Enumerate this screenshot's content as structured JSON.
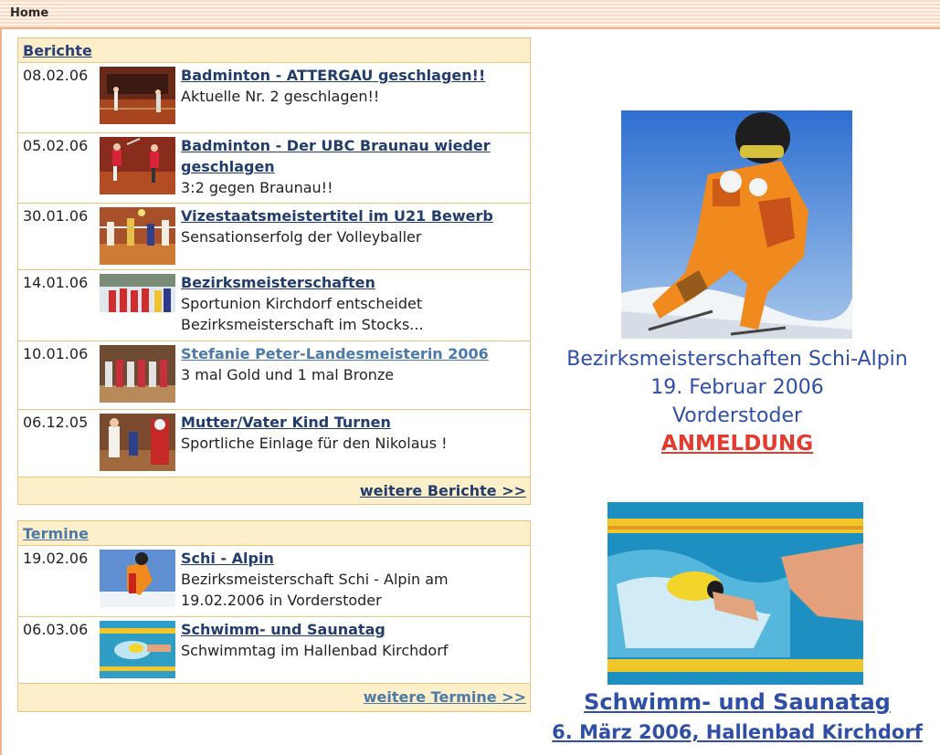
{
  "nav": {
    "home": "Home"
  },
  "berichte": {
    "title": "Berichte",
    "items": [
      {
        "date": "08.02.06",
        "title": "Badminton - ATTERGAU geschlagen!!",
        "lines": [
          "Aktuelle Nr. 2 geschlagen!!"
        ]
      },
      {
        "date": "05.02.06",
        "title": "Badminton - Der UBC Braunau wieder geschlagen",
        "lines": [
          "3:2 gegen Braunau!!"
        ]
      },
      {
        "date": "30.01.06",
        "title": "Vizestaatsmeistertitel im U21 Bewerb",
        "lines": [
          "Sensationserfolg der Volleyballer"
        ]
      },
      {
        "date": "14.01.06",
        "title": "Bezirksmeisterschaften",
        "lines": [
          "Sportunion Kirchdorf entscheidet",
          "Bezirksmeisterschaft im Stocks..."
        ]
      },
      {
        "date": "10.01.06",
        "title": "Stefanie Peter-Landesmeisterin 2006",
        "lines": [
          "3 mal Gold und 1 mal Bronze"
        ]
      },
      {
        "date": "06.12.05",
        "title": "Mutter/Vater Kind Turnen",
        "lines": [
          "Sportliche Einlage für den Nikolaus !"
        ]
      }
    ],
    "more": "weitere Berichte >>"
  },
  "termine": {
    "title": "Termine",
    "items": [
      {
        "date": "19.02.06",
        "title": "Schi - Alpin",
        "lines": [
          "Bezirksmeisterschaft Schi - Alpin am",
          "19.02.2006 in Vorderstoder"
        ]
      },
      {
        "date": "06.03.06",
        "title": "Schwimm- und Saunatag",
        "lines": [
          "Schwimmtag im Hallenbad Kirchdorf"
        ]
      }
    ],
    "more": "weitere Termine >>"
  },
  "promo_ski": {
    "line1": "Bezirksmeisterschaften Schi-Alpin",
    "line2": "19. Februar 2006",
    "line3": "Vorderstoder",
    "register": "ANMELDUNG"
  },
  "promo_swim": {
    "line1": "Schwimm- und Saunatag",
    "line2": "6. März 2006, Hallenbad Kirchdorf"
  },
  "colors": {
    "link": "#223d6b",
    "accent_red": "#e23b2f",
    "promo_blue": "#2f4fa6",
    "box_border": "#e8c57e"
  }
}
